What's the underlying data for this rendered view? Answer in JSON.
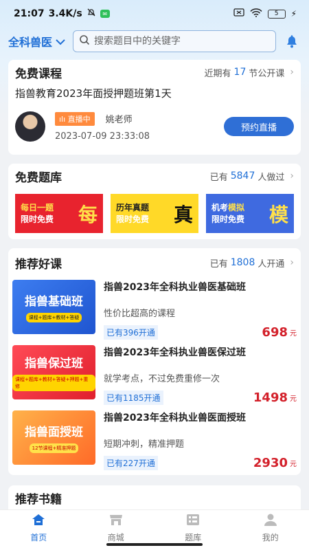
{
  "status": {
    "time": "21:07",
    "speed": "3.4K/s",
    "battery": "5"
  },
  "header": {
    "region": "全科兽医",
    "search_placeholder": "搜索题目中的关键字"
  },
  "free_course": {
    "title": "免费课程",
    "meta_prefix": "近期有",
    "meta_count": "17",
    "meta_suffix": "节公开课",
    "live_title": "指兽教育2023年面授押题班第1天",
    "badge": "直播中",
    "teacher": "姚老师",
    "datetime": "2023-07-09 23:33:08",
    "book_button": "预约直播"
  },
  "free_bank": {
    "title": "免费题库",
    "meta_prefix": "已有",
    "meta_count": "5847",
    "meta_suffix": "人做过",
    "tiles": [
      {
        "line1": "每日一题",
        "line2": "限时免费",
        "big": "每"
      },
      {
        "line1": "历年真题",
        "line2": "限时免费",
        "big": "真"
      },
      {
        "line1a": "机考",
        "line1b": "模拟",
        "line2": "限时免费",
        "big": "模"
      }
    ]
  },
  "recommended": {
    "title": "推荐好课",
    "meta_prefix": "已有",
    "meta_count": "1808",
    "meta_suffix": "人开通",
    "courses": [
      {
        "thumb_title": "指兽基础班",
        "thumb_tag": "课程+题库+教材+答疑",
        "title": "指兽2023年全科执业兽医基础班",
        "desc": "性价比超高的课程",
        "enrolled": "已有396开通",
        "price": "698",
        "unit": "元"
      },
      {
        "thumb_title": "指兽保过班",
        "thumb_tag": "课程+题库+教材+答疑+押题+重修",
        "title": "指兽2023年全科执业兽医保过班",
        "desc": "就学考点，不过免费重修一次",
        "enrolled": "已有1185开通",
        "price": "1498",
        "unit": "元"
      },
      {
        "thumb_title": "指兽面授班",
        "thumb_tag": "12节课程+精准押题",
        "title": "指兽2023年全科执业兽医面授班",
        "desc": "短期冲刺，精准押题",
        "enrolled": "已有227开通",
        "price": "2930",
        "unit": "元"
      }
    ]
  },
  "books": {
    "title": "推荐书籍"
  },
  "tabbar": [
    {
      "label": "首页",
      "icon": "home-icon"
    },
    {
      "label": "商城",
      "icon": "shop-icon"
    },
    {
      "label": "题库",
      "icon": "question-bank-icon"
    },
    {
      "label": "我的",
      "icon": "profile-icon"
    }
  ],
  "colors": {
    "accent": "#1f6fd6",
    "price": "#d3202a"
  }
}
